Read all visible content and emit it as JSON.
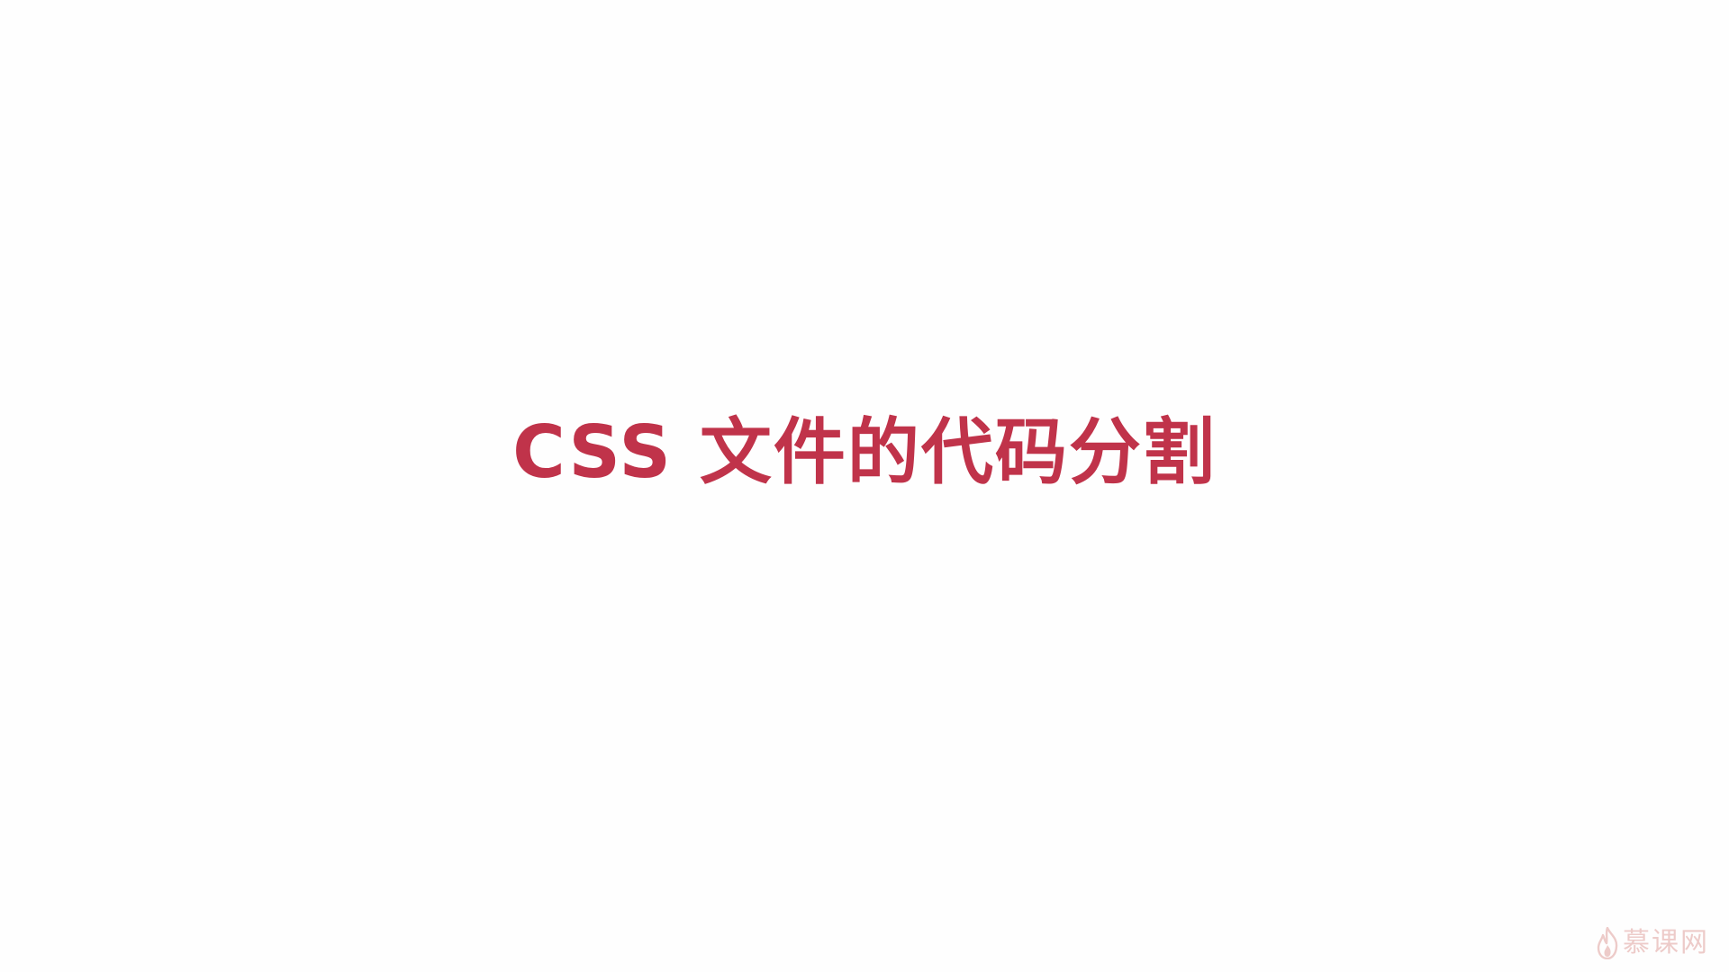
{
  "slide": {
    "title": "CSS 文件的代码分割",
    "title_color": "#c0334a"
  },
  "watermark": {
    "text": "慕课网",
    "icon": "flame-icon",
    "color": "#e0a39f"
  }
}
